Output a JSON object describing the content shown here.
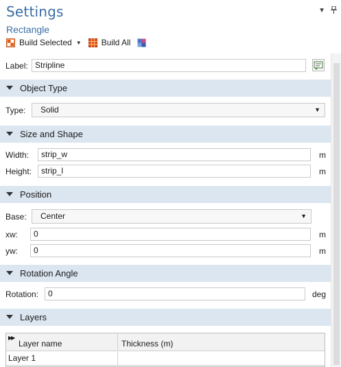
{
  "header": {
    "title": "Settings",
    "subtitle": "Rectangle",
    "dropdown_glyph": "▼",
    "pin_glyph": "⊥"
  },
  "toolbar": {
    "build_selected": "Build Selected",
    "build_all": "Build All"
  },
  "label_row": {
    "label": "Label:",
    "value": "Stripline"
  },
  "object_type": {
    "section": "Object Type",
    "type_label": "Type:",
    "type_value": "Solid"
  },
  "size_shape": {
    "section": "Size and Shape",
    "width_label": "Width:",
    "width_value": "strip_w",
    "width_unit": "m",
    "height_label": "Height:",
    "height_value": "strip_l",
    "height_unit": "m"
  },
  "position": {
    "section": "Position",
    "base_label": "Base:",
    "base_value": "Center",
    "xw_label": "xw:",
    "xw_value": "0",
    "xw_unit": "m",
    "yw_label": "yw:",
    "yw_value": "0",
    "yw_unit": "m"
  },
  "rotation": {
    "section": "Rotation Angle",
    "label": "Rotation:",
    "value": "0",
    "unit": "deg"
  },
  "layers": {
    "section": "Layers",
    "columns": [
      "Layer name",
      "Thickness (m)"
    ],
    "rows": [
      {
        "name": "Layer 1",
        "thickness": ""
      }
    ]
  },
  "icons": {
    "build_selected": "build-selected-icon",
    "build_all": "build-all-icon",
    "refresh": "refresh-icon",
    "edit_label": "edit-label-icon"
  }
}
